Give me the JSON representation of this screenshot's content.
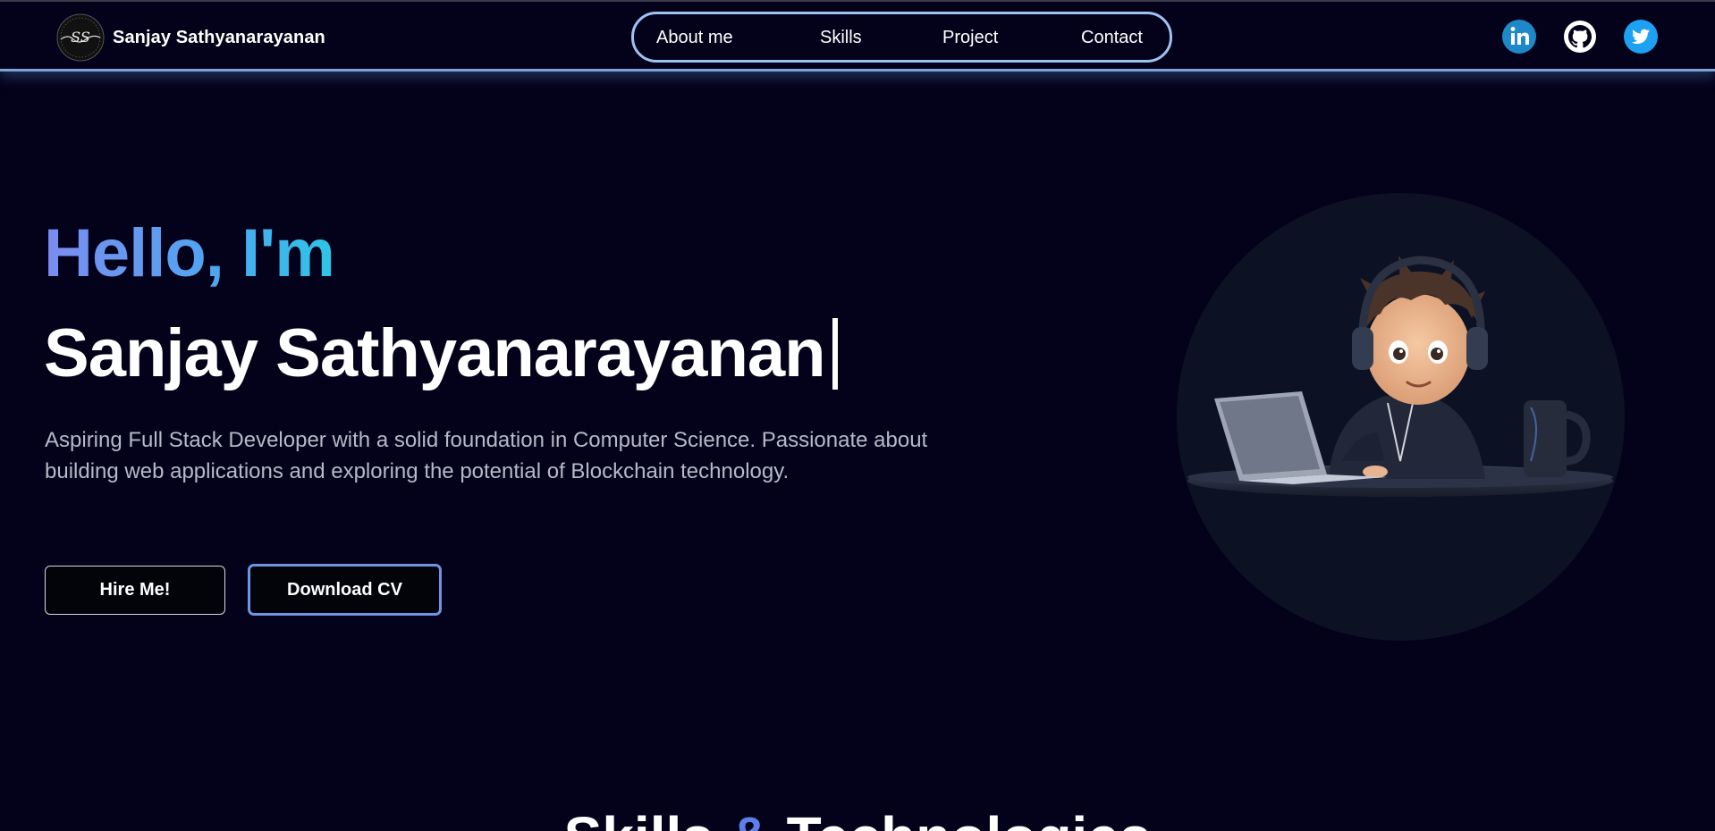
{
  "navbar": {
    "brand_name": "Sanjay Sathyanarayanan",
    "logo_icon": "signature-logo-icon",
    "links": [
      {
        "label": "About me"
      },
      {
        "label": "Skills"
      },
      {
        "label": "Project"
      },
      {
        "label": "Contact"
      }
    ],
    "socials": [
      {
        "icon": "linkedin-icon",
        "color": "#1e88c8"
      },
      {
        "icon": "github-icon",
        "color": "#ffffff"
      },
      {
        "icon": "twitter-icon",
        "color": "#1da1f2"
      }
    ]
  },
  "hero": {
    "greeting": "Hello, I'm",
    "name": "Sanjay Sathyanarayanan",
    "description": "Aspiring Full Stack Developer with a solid foundation in Computer Science. Passionate about building web applications and exploring the potential of Blockchain technology.",
    "hire_button": "Hire Me!",
    "cv_button": "Download CV",
    "illustration_icon": "developer-avatar-illustration"
  },
  "next_section": {
    "heading_part1": "Skills ",
    "heading_accent": "&",
    "heading_part2": " Technologies"
  },
  "colors": {
    "background": "#03021a",
    "accent_blue": "#6f93e6",
    "nav_border": "#9fc2f0",
    "gradient_start": "#7b8cf0",
    "gradient_end": "#2ec5e6"
  }
}
